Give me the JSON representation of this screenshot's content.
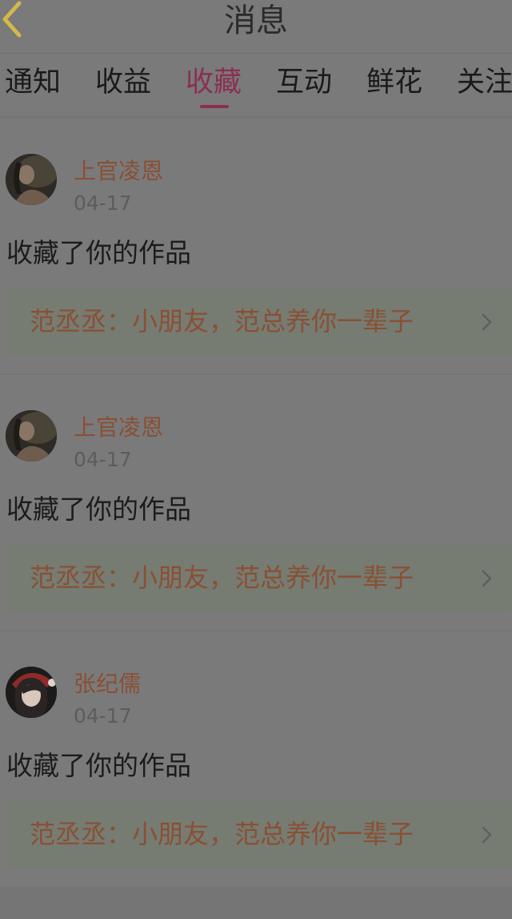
{
  "header": {
    "title": "消息",
    "back_icon": "chevron-left-icon",
    "accent_color": "#d4b94a"
  },
  "tabs": [
    {
      "label": "通知",
      "active": false
    },
    {
      "label": "收益",
      "active": false
    },
    {
      "label": "收藏",
      "active": true
    },
    {
      "label": "互动",
      "active": false
    },
    {
      "label": "鲜花",
      "active": false
    },
    {
      "label": "关注",
      "active": false
    }
  ],
  "colors": {
    "active_tab": "#8b2f52",
    "username": "#8a4f34",
    "link_bg": "#767c72"
  },
  "notifications": [
    {
      "username": "上官凌恩",
      "date": "04-17",
      "action": "收藏了你的作品",
      "work_title": "范丞丞：小朋友，范总养你一辈子",
      "avatar": "avatar-photo"
    },
    {
      "username": "上官凌恩",
      "date": "04-17",
      "action": "收藏了你的作品",
      "work_title": "范丞丞：小朋友，范总养你一辈子",
      "avatar": "avatar-photo"
    },
    {
      "username": "张纪儒",
      "date": "04-17",
      "action": "收藏了你的作品",
      "work_title": "范丞丞：小朋友，范总养你一辈子",
      "avatar": "avatar-photo"
    }
  ]
}
